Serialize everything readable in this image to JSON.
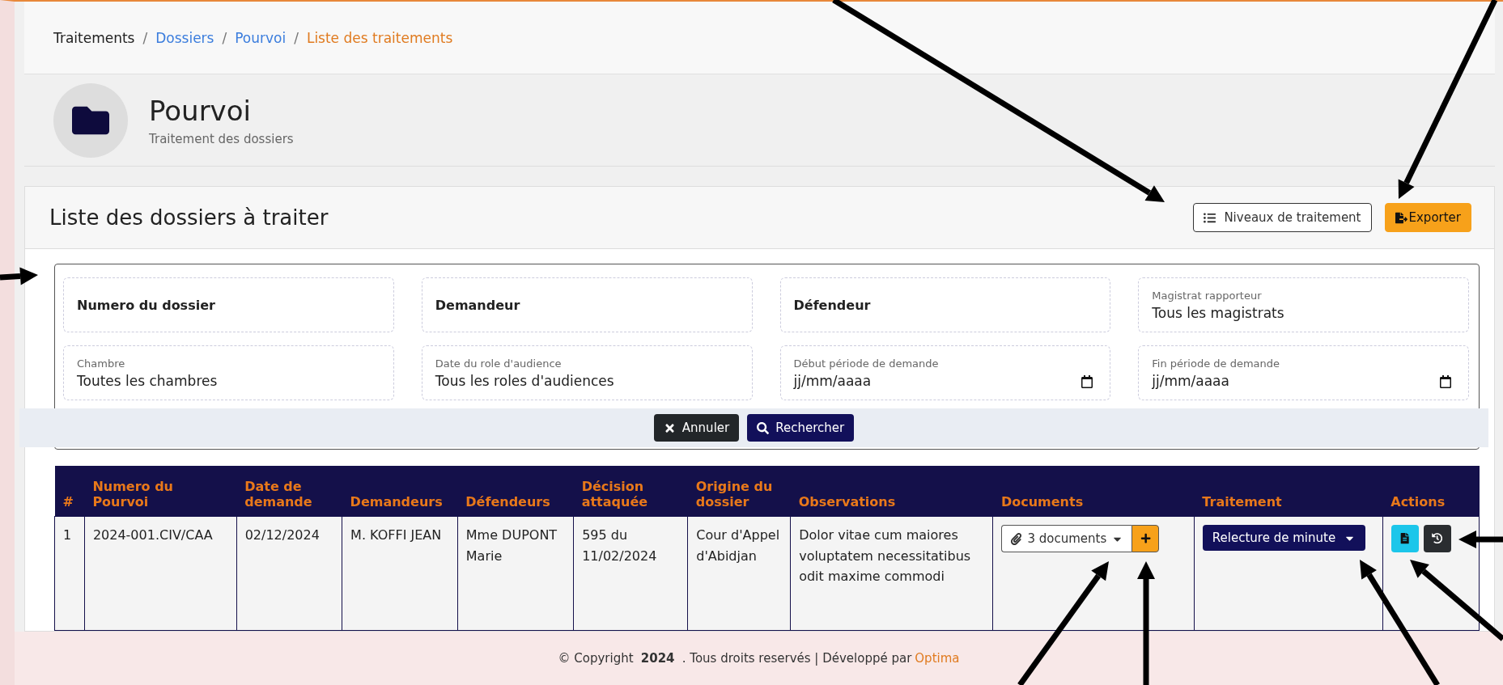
{
  "breadcrumb": [
    {
      "label": "Traitements",
      "kind": "plain"
    },
    {
      "label": "/",
      "kind": "separator"
    },
    {
      "label": "Dossiers",
      "kind": "link"
    },
    {
      "label": "/",
      "kind": "separator"
    },
    {
      "label": "Pourvoi",
      "kind": "link"
    },
    {
      "label": "/",
      "kind": "separator"
    },
    {
      "label": "Liste des traitements",
      "kind": "current"
    }
  ],
  "header": {
    "title": "Pourvoi",
    "subtitle": "Traitement des dossiers"
  },
  "card": {
    "title": "Liste des dossiers à traiter",
    "buttons": [
      {
        "label": "Niveaux de traitement",
        "kind": "outline"
      },
      {
        "label": "Exporter",
        "kind": "export"
      }
    ]
  },
  "filters": [
    {
      "kind": "input",
      "placeholder": "Numero du dossier"
    },
    {
      "kind": "input",
      "placeholder": "Demandeur"
    },
    {
      "kind": "input",
      "placeholder": "Défendeur"
    },
    {
      "kind": "select",
      "label": "Magistrat rapporteur",
      "value": "Tous les magistrats"
    },
    {
      "kind": "select",
      "label": "Chambre",
      "value": "Toutes les chambres"
    },
    {
      "kind": "select",
      "label": "Date du role d'audience",
      "value": "Tous les roles d'audiences"
    },
    {
      "kind": "date",
      "label": "Début période de demande",
      "value": "jj/mm/aaaa"
    },
    {
      "kind": "date",
      "label": "Fin période de demande",
      "value": "jj/mm/aaaa"
    }
  ],
  "filter_buttons": [
    {
      "label": "Annuler",
      "kind": "cancel"
    },
    {
      "label": "Rechercher",
      "kind": "search"
    }
  ],
  "table": {
    "columns": [
      "#",
      "Numero du Pourvoi",
      "Date de demande",
      "Demandeurs",
      "Défendeurs",
      "Décision attaquée",
      "Origine du dossier",
      "Observations",
      "Documents",
      "Traitement",
      "Actions"
    ],
    "rows": [
      {
        "cells": [
          "1",
          "2024-001.CIV/CAA",
          "02/12/2024",
          "M. KOFFI JEAN",
          "Mme DUPONT Marie",
          "595 du 11/02/2024",
          "Cour d'Appel d'Abidjan",
          "Dolor vitae cum maiores voluptatem necessitatibus odit maxime commodi"
        ],
        "documents": "3 documents",
        "traitement": "Relecture de minute"
      }
    ]
  },
  "footer": {
    "prefix": "© Copyright",
    "year": "2024",
    "middle": ". Tous droits reservés | Développé par",
    "brand": "Optima"
  }
}
